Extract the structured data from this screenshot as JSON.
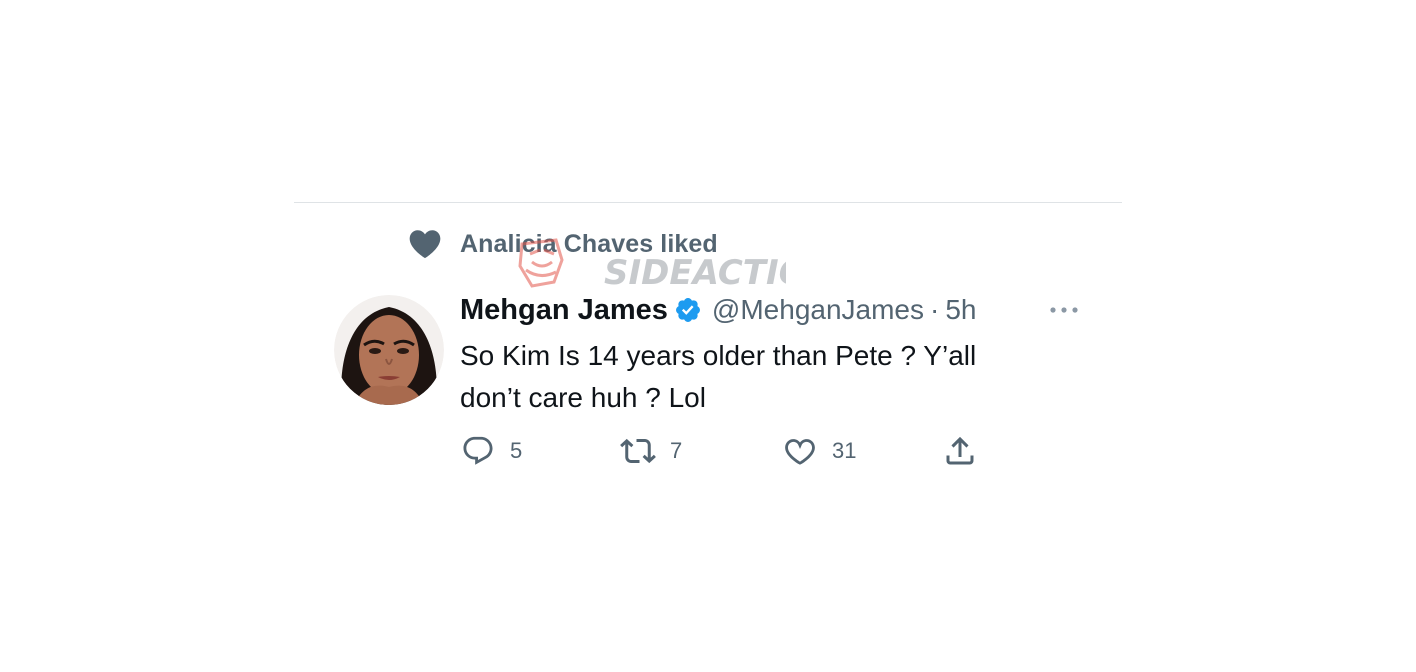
{
  "social_context": {
    "text": "Analicia Chaves liked",
    "icon": "heart-filled-icon"
  },
  "watermark": {
    "text": "SIDEACTION"
  },
  "tweet": {
    "display_name": "Mehgan James",
    "verified": true,
    "handle": "@MehganJames",
    "separator": "·",
    "time": "5h",
    "text_line1": "So Kim Is 14 years older than Pete ? Y’all",
    "text_line2": "don’t care huh ? Lol",
    "replies": "5",
    "retweets": "7",
    "likes": "31"
  },
  "colors": {
    "secondary_text": "#536471",
    "primary_text": "#0f1419",
    "verified_blue": "#1d9bf0",
    "divider": "#dfe3e6"
  }
}
